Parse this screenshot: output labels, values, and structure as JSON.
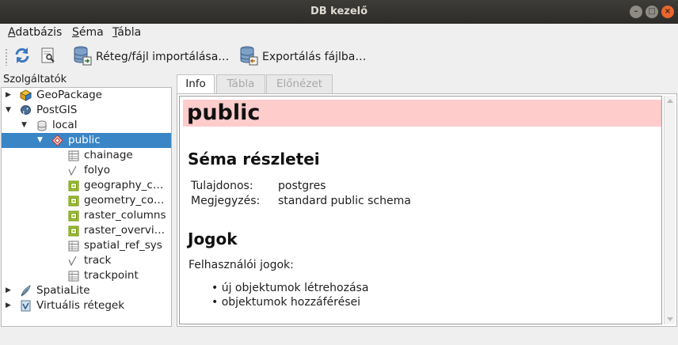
{
  "window": {
    "title": "DB kezelő"
  },
  "menu": [
    {
      "accel": "A",
      "rest": "datbázis"
    },
    {
      "accel": "S",
      "rest": "éma"
    },
    {
      "accel": "T",
      "rest": "ábla"
    }
  ],
  "toolbar": {
    "import_label": "Réteg/fájl importálása…",
    "export_label": "Exportálás fájlba…"
  },
  "tree": {
    "header": "Szolgáltatók",
    "nodes": [
      {
        "label": "GeoPackage",
        "icon": "geopackage-icon",
        "level": 0,
        "arrow": "collapsed"
      },
      {
        "label": "PostGIS",
        "icon": "postgis-elephant-icon",
        "level": 0,
        "arrow": "expanded"
      },
      {
        "label": "local",
        "icon": "database-icon",
        "level": 1,
        "arrow": "expanded"
      },
      {
        "label": "public",
        "icon": "schema-icon",
        "level": 2,
        "arrow": "expanded",
        "selected": true
      },
      {
        "label": "chainage",
        "icon": "table-icon",
        "level": 3
      },
      {
        "label": "folyo",
        "icon": "line-layer-icon",
        "level": 3
      },
      {
        "label": "geography_c…",
        "icon": "view-icon",
        "level": 3
      },
      {
        "label": "geometry_co…",
        "icon": "view-icon",
        "level": 3
      },
      {
        "label": "raster_columns",
        "icon": "view-icon",
        "level": 3
      },
      {
        "label": "raster_overvi…",
        "icon": "view-icon",
        "level": 3
      },
      {
        "label": "spatial_ref_sys",
        "icon": "table-icon",
        "level": 3
      },
      {
        "label": "track",
        "icon": "line-layer-icon",
        "level": 3
      },
      {
        "label": "trackpoint",
        "icon": "table-icon",
        "level": 3
      },
      {
        "label": "SpatiaLite",
        "icon": "spatialite-feather-icon",
        "level": 0,
        "arrow": "collapsed"
      },
      {
        "label": "Virtuális rétegek",
        "icon": "virtual-layers-icon",
        "level": 0,
        "arrow": "collapsed"
      }
    ]
  },
  "tabs": [
    {
      "label": "Info",
      "active": true
    },
    {
      "label": "Tábla",
      "active": false
    },
    {
      "label": "Előnézet",
      "active": false
    }
  ],
  "info": {
    "schema_name": "public",
    "details_heading": "Séma részletei",
    "owner_key": "Tulajdonos:",
    "owner_value": "postgres",
    "comment_key": "Megjegyzés:",
    "comment_value": "standard public schema",
    "rights_heading": "Jogok",
    "user_rights_label": "Felhasználói jogok:",
    "rights": [
      "új objektumok létrehozása",
      "objektumok hozzáférései"
    ]
  },
  "colors": {
    "selection": "#3a85c6",
    "schema_header_bg": "#ffcccc",
    "titlebar": "#2d2c29",
    "close_button": "#e9662c"
  }
}
